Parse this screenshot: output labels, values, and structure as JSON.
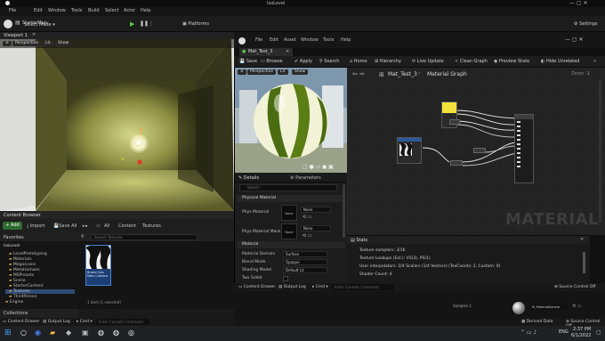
{
  "editor": {
    "project": "StarterMap",
    "window_title": "IsoLevel",
    "menus": [
      "File",
      "Edit",
      "Window",
      "Tools",
      "Build",
      "Select",
      "Actor",
      "Help"
    ],
    "select_mode": "Select Mode",
    "platforms": "Platforms",
    "settings": "Settings"
  },
  "viewport": {
    "tab": "Viewport 1",
    "perspective": "Perspective",
    "lit": "Lit",
    "show": "Show"
  },
  "content_browser": {
    "tab": "Content Browser",
    "add": "Add",
    "import": "Import",
    "save_all": "Save All",
    "breadcrumb": [
      "All",
      "Content",
      "Textures"
    ],
    "favorites": "Favorites",
    "search_placeholder": "Search Textures",
    "root": "IsoLevel",
    "tree": [
      "LevelPrototyping",
      "Materials",
      "Megascans",
      "MetaHumans",
      "MSPresets",
      "Scene",
      "StarterContent",
      "Textures",
      "ThirdPerson",
      "Engine"
    ],
    "asset_name": "Brand Cols Ntex Camera",
    "collections": "Collections",
    "item_count": "1 item (1 selected)"
  },
  "material_editor": {
    "menus": [
      "File",
      "Edit",
      "Asset",
      "Window",
      "Tools",
      "Help"
    ],
    "tab": "Mat_Test_3",
    "toolbar": [
      "Save",
      "Browse",
      "Apply",
      "Search",
      "Home",
      "Hierarchy",
      "Live Update",
      "Clean Graph",
      "Preview State",
      "Hide Unrelated"
    ],
    "breadcrumb": [
      "Mat_Test_3",
      "Material Graph"
    ],
    "preview": {
      "perspective": "Perspective",
      "lit": "Lit",
      "show": "Show"
    },
    "details_tab": "Details",
    "parameters_tab": "Parameters",
    "search_placeholder": "Search",
    "physical_section": "Physical Material",
    "phys_material_label": "Phys Material",
    "phys_material_value": "None",
    "phys_material_mask_label": "Phys Material Mask",
    "phys_material_mask_value": "None",
    "material_section": "Material",
    "props": [
      {
        "label": "Material Domain",
        "value": "Surface"
      },
      {
        "label": "Blend Mode",
        "value": "Opaque"
      },
      {
        "label": "Shading Model",
        "value": "Default Lit"
      },
      {
        "label": "Two Sided",
        "value": ""
      }
    ],
    "watermark": "MATERIAL",
    "zoom": "Zoom -1",
    "stats_tab": "Stats",
    "stats": [
      "Texture samplers: 3/16",
      "Texture Lookups (Est.): VS(3), PS(1)",
      "User interpolators: 2/4 Scalars (1/4 Vectors) (TexCoords: 2, Custom: 0)",
      "Shader Count: 4"
    ],
    "bottom_buttons": [
      "Content Drawer",
      "Output Log",
      "Cmd"
    ],
    "console_placeholder": "Enter Console Command",
    "source_control": "Source Control Off",
    "sample_label": "Samples 1",
    "sample_asset": "M_MaterialSphere",
    "derived_data": "Derived Data"
  },
  "statusbar": {
    "content_drawer": "Content Drawer",
    "output_log": "Output Log",
    "cmd": "Cmd",
    "console_placeholder": "Enter Console Command",
    "source_control": "Source Control Off"
  },
  "taskbar": {
    "lang": "ENG",
    "time": "2:37 PM",
    "date": "6/1/2022"
  }
}
